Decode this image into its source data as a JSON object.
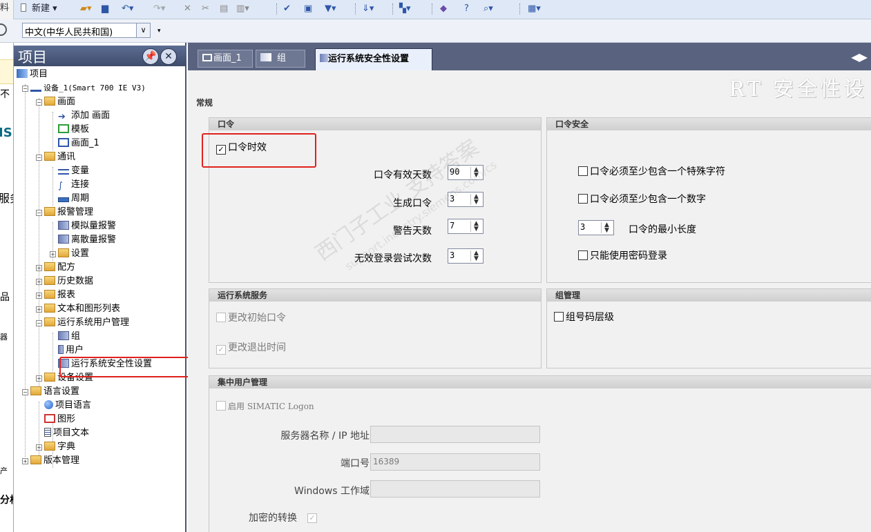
{
  "toolbar": {
    "truncated_left": "料",
    "new_label": "新建",
    "items_icons": [
      "open-folder-icon",
      "save-icon",
      "undo-icon",
      "redo-icon",
      "delete-icon",
      "cut-icon",
      "copy-icon",
      "paste-icon",
      "check-icon",
      "compile-icon",
      "download-icon",
      "sort-icon",
      "layer-icon",
      "object-icon",
      "help-icon",
      "search-help-icon",
      "window-icon"
    ]
  },
  "language": {
    "selected": "中文(中华人民共和国)"
  },
  "sliver": {
    "items": [
      "不",
      "IS",
      "服务",
      "品",
      "器",
      "产",
      "分析"
    ]
  },
  "project_tree": {
    "title": "项目",
    "nodes": [
      {
        "label": "项目"
      },
      {
        "label": "设备_1(Smart 700 IE V3)"
      },
      {
        "label": "画面"
      },
      {
        "label": "添加 画面"
      },
      {
        "label": "模板"
      },
      {
        "label": "画面_1"
      },
      {
        "label": "通讯"
      },
      {
        "label": "变量"
      },
      {
        "label": "连接"
      },
      {
        "label": "周期"
      },
      {
        "label": "报警管理"
      },
      {
        "label": "模拟量报警"
      },
      {
        "label": "离散量报警"
      },
      {
        "label": "设置"
      },
      {
        "label": "配方"
      },
      {
        "label": "历史数据"
      },
      {
        "label": "报表"
      },
      {
        "label": "文本和图形列表"
      },
      {
        "label": "运行系统用户管理"
      },
      {
        "label": "组"
      },
      {
        "label": "用户"
      },
      {
        "label": "运行系统安全性设置"
      },
      {
        "label": "设备设置"
      },
      {
        "label": "语言设置"
      },
      {
        "label": "项目语言"
      },
      {
        "label": "图形"
      },
      {
        "label": "项目文本"
      },
      {
        "label": "字典"
      },
      {
        "label": "版本管理"
      }
    ]
  },
  "tabs": [
    {
      "label": "画面_1"
    },
    {
      "label": "组"
    },
    {
      "label": "运行系统安全性设置"
    }
  ],
  "editor": {
    "big_title": "RT 安全性设",
    "section_general": "常规",
    "password": {
      "header": "口令",
      "aging_label": "口令时效",
      "aging_checked": true,
      "valid_days_label": "口令有效天数",
      "valid_days": "90",
      "generations_label": "生成口令",
      "generations": "3",
      "warning_days_label": "警告天数",
      "warning_days": "7",
      "invalid_login_label": "无效登录尝试次数",
      "invalid_login": "3"
    },
    "password_security": {
      "header": "口令安全",
      "special_char": "口令必须至少包含一个特殊字符",
      "digit": "口令必须至少包含一个数字",
      "min_length_value": "3",
      "min_length_label": "口令的最小长度",
      "password_only": "只能使用密码登录"
    },
    "runtime_services": {
      "header": "运行系统服务",
      "change_initial": "更改初始口令",
      "change_logout": "更改退出时间"
    },
    "group_mgmt": {
      "header": "组管理",
      "group_hierarchy": "组号码层级"
    },
    "central_user": {
      "header": "集中用户管理",
      "enable_logon": "启用 SIMATIC Logon",
      "server_label": "服务器名称 / IP 地址",
      "server_value": "",
      "port_label": "端口号",
      "port_value": "16389",
      "domain_label": "Windows 工作域",
      "domain_value": "",
      "encrypt_label": "加密的转换"
    },
    "watermark": "西门子工业 支持答案",
    "watermark_url": "support.industry.siemens.com/cs"
  }
}
